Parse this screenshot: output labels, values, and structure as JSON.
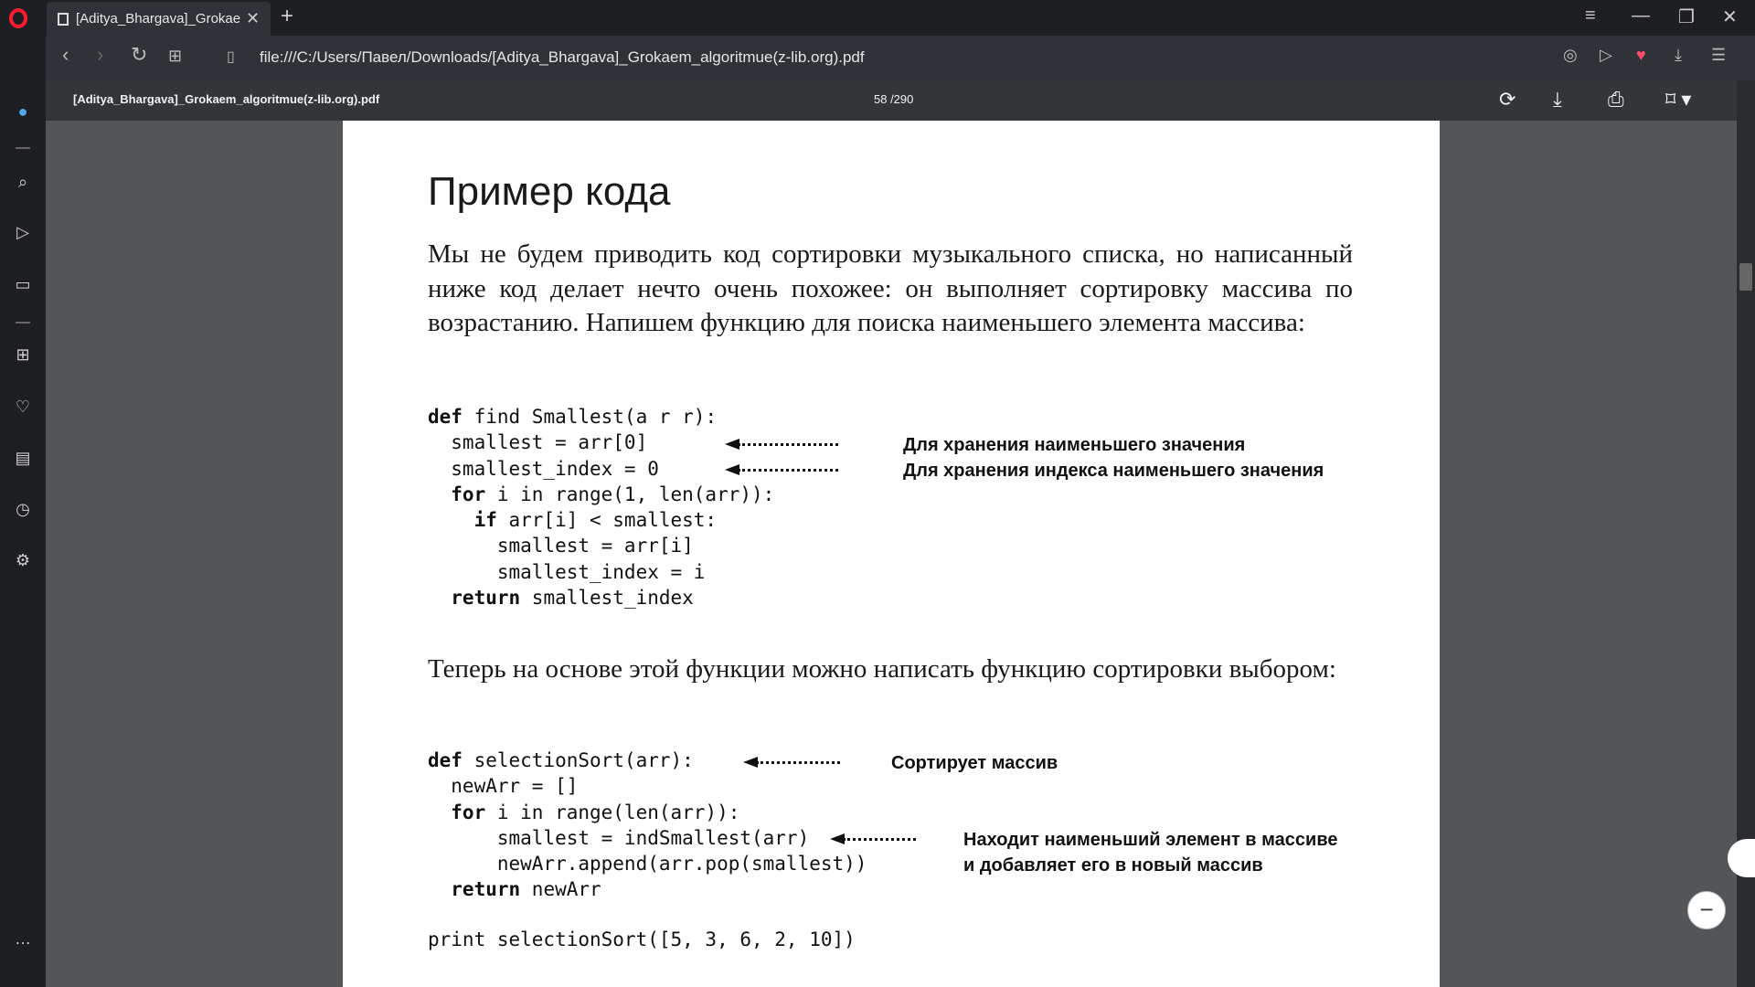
{
  "browser": {
    "tab_title": "[Aditya_Bhargava]_Grokaem_algoritmue(z-lib.org).pdf",
    "tab_close": "✕",
    "new_tab": "+",
    "url": "file:///C:/Users/Павел/Downloads/[Aditya_Bhargava]_Grokaem_algoritmue(z-lib.org).pdf"
  },
  "pdf_toolbar": {
    "file_name": "[Aditya_Bhargava]_Grokaem_algoritmue(z-lib.org).pdf",
    "page_indicator": "58 /290"
  },
  "document": {
    "heading": "Пример кода",
    "paragraph1": "Мы не будем приводить код сортировки музыкального списка, но написанный ниже код делает нечто очень похожее: он выполняет сортировку массива по возрастанию. Напишем функцию для поиска наименьшего элемента массива:",
    "code1": [
      {
        "kw": "def",
        "text": " find Smallest(a r r):"
      },
      {
        "kw": "",
        "text": "  smallest = arr[0]"
      },
      {
        "kw": "",
        "text": "  smallest_index = 0"
      },
      {
        "kw": "  for",
        "text": " i in range(1, len(arr)):"
      },
      {
        "kw": "    if",
        "text": " arr[i] < smallest:"
      },
      {
        "kw": "",
        "text": "      smallest = arr[i]"
      },
      {
        "kw": "",
        "text": "      smallest_index = i"
      },
      {
        "kw": "  return",
        "text": " smallest_index"
      }
    ],
    "annotation1": "Для хранения наименьшего значения",
    "annotation2": "Для хранения индекса наименьшего значения",
    "paragraph2": "Теперь на основе этой функции можно написать функцию сортировки выбором:",
    "code2": [
      {
        "kw": "def",
        "text": " selectionSort(arr):"
      },
      {
        "kw": "",
        "text": "  newArr = []"
      },
      {
        "kw": "  for",
        "text": " i in range(len(arr)):"
      },
      {
        "kw": "",
        "text": "      smallest = indSmallest(arr)"
      },
      {
        "kw": "",
        "text": "      newArr.append(arr.pop(smallest))"
      },
      {
        "kw": "  return",
        "text": " newArr"
      }
    ],
    "annotation3": "Сортирует массив",
    "annotation4_line1": "Находит наименьший элемент в массиве",
    "annotation4_line2": "и добавляет его в новый массив",
    "code3": "print selectionSort([5, 3, 6, 2, 10])"
  },
  "zoom": {
    "out_label": "−"
  }
}
